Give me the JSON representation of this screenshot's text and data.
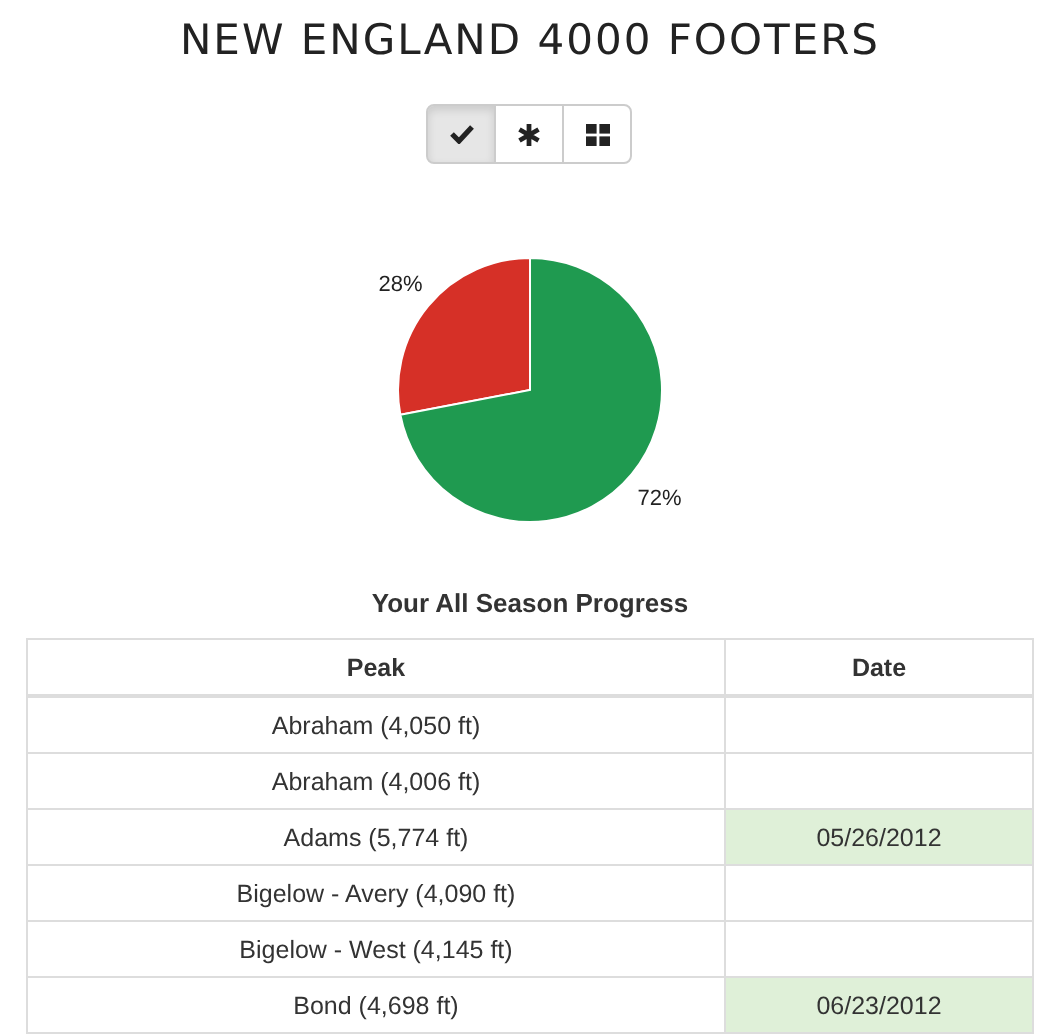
{
  "title": "NEW ENGLAND 4000 FOOTERS",
  "view_buttons": [
    {
      "kind": "check",
      "selected": true
    },
    {
      "kind": "asterisk",
      "selected": false
    },
    {
      "kind": "grid",
      "selected": false
    }
  ],
  "chart": {
    "chart_data": {
      "type": "pie",
      "value_labels": [
        "28%",
        "72%"
      ],
      "series": [
        {
          "values": [
            28,
            72
          ],
          "colors": [
            "#d63027",
            "#1f9a50"
          ]
        }
      ]
    }
  },
  "table": {
    "title": "Your All Season Progress",
    "columns": [
      "Peak",
      "Date"
    ],
    "rows": [
      {
        "peak": "Abraham (4,050 ft)",
        "done": false
      },
      {
        "peak": "Abraham (4,006 ft)",
        "done": false
      },
      {
        "peak": "Adams (5,774 ft)",
        "date": "05/26/2012",
        "done": true
      },
      {
        "peak": "Bigelow - Avery (4,090 ft)",
        "done": false
      },
      {
        "peak": "Bigelow - West (4,145 ft)",
        "done": false
      },
      {
        "peak": "Bond (4,698 ft)",
        "date": "06/23/2012",
        "done": true
      }
    ]
  }
}
